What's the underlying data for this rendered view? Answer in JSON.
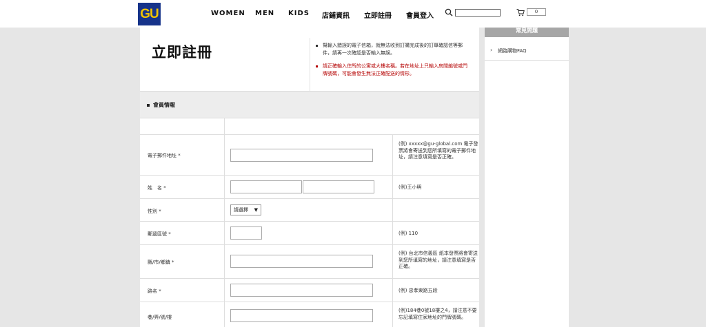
{
  "header": {
    "logo": "GU",
    "nav": [
      "WOMEN",
      "MEN",
      "KIDS",
      "店鋪資訊",
      "立即註冊",
      "會員登入"
    ],
    "search_placeholder": "",
    "cart_count": "0"
  },
  "main": {
    "title": "立即註冊",
    "notices": [
      "幫輸入錯誤的電子信箱，就無法收到訂購完成後的訂單確認信等郵件，請再一次確認是否輸入無誤。",
      "請正確輸入住所的公寓或大樓名稱。若在地址上只輸入房間編號或門牌號碼，可能會發生無法正確配送的情形。"
    ],
    "section_label": "會員情報",
    "rows": [
      {
        "label": "",
        "hint": ""
      },
      {
        "label": "電子郵件地址 *",
        "hint": "(例) xxxxx@gu-global.com 電子發票將會寄送到您所填寫的電子郵件地址，請注意填寫是否正確。"
      },
      {
        "label": "姓　名 *",
        "hint": "(例)王小明"
      },
      {
        "label": "性別 *",
        "hint": "",
        "select_value": "請選擇"
      },
      {
        "label": "郵遞區號 *",
        "hint": "(例) 110"
      },
      {
        "label": "縣/市/鄉鎮 *",
        "hint": "(例) 台北市信義區 紙本發票將會寄送到您所填寫的地址，請注意填寫是否正確。"
      },
      {
        "label": "路名 *",
        "hint": "(例) 忠孝東路五段"
      },
      {
        "label": "巷/弄/號/樓",
        "hint": "(例)184巷0號18樓之4，請注意不要忘記填寫住家地址的門牌號碼。"
      }
    ]
  },
  "sidebar": {
    "title": "常見問題",
    "items": [
      "網路購物FAQ"
    ]
  },
  "colors": {
    "logo_bg": "#16338a",
    "logo_text": "#f2c400",
    "warning_text": "#b40000",
    "page_bg": "#e6e6e6"
  }
}
